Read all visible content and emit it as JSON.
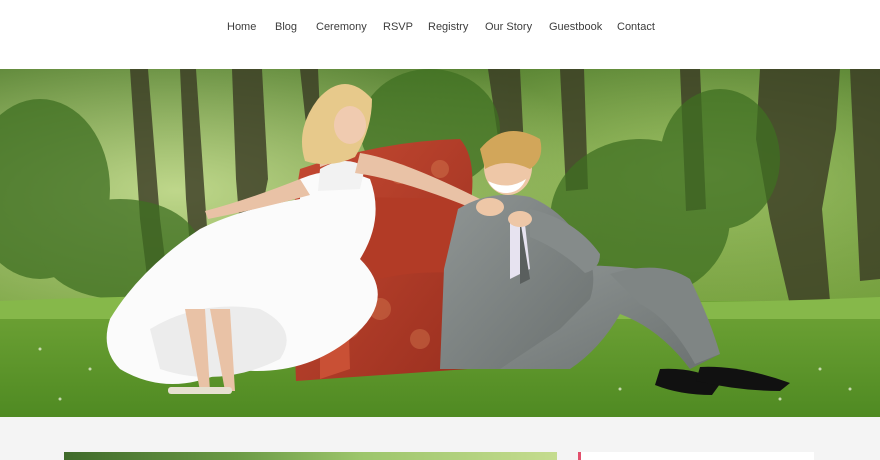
{
  "nav": {
    "items": [
      {
        "label": "Home"
      },
      {
        "label": "Blog"
      },
      {
        "label": "Ceremony"
      },
      {
        "label": "RSVP"
      },
      {
        "label": "Registry"
      },
      {
        "label": "Our Story"
      },
      {
        "label": "Guestbook"
      },
      {
        "label": "Contact"
      }
    ]
  },
  "hero": {
    "image": "wedding-couple-photo"
  },
  "colors": {
    "accent": "#e2506d",
    "nav_text": "#3d3d3d",
    "page_background": "#f4f4f4"
  }
}
